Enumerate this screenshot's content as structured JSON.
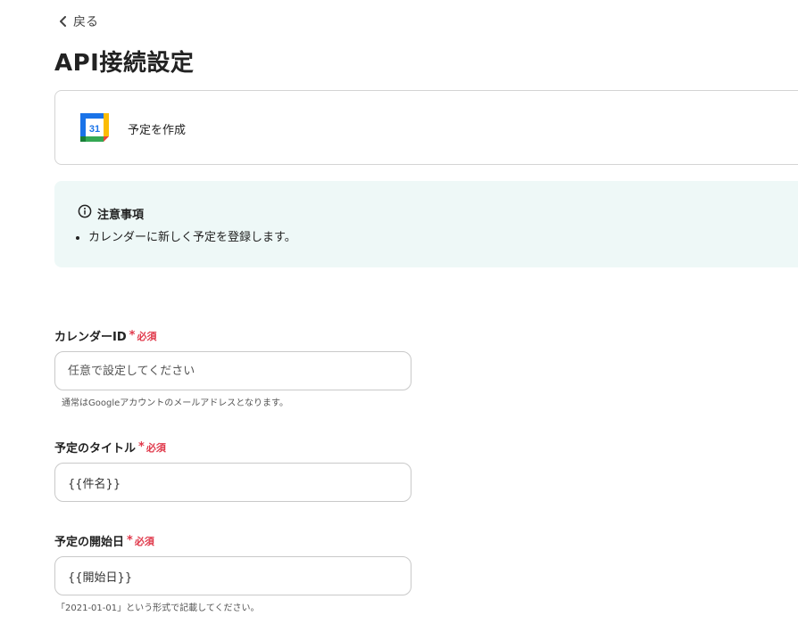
{
  "nav": {
    "back_label": "戻る"
  },
  "page": {
    "title": "API接続設定"
  },
  "action": {
    "icon": "google-calendar-icon",
    "icon_text": "31",
    "label": "予定を作成"
  },
  "notice": {
    "title": "注意事項",
    "items": [
      "カレンダーに新しく予定を登録します。"
    ]
  },
  "form": {
    "required_star": "*",
    "required_text": "必須",
    "fields": [
      {
        "label": "カレンダーID",
        "value": "",
        "placeholder": "任意で設定してください",
        "hint": "通常はGoogleアカウントのメールアドレスとなります。"
      },
      {
        "label": "予定のタイトル",
        "value": "{{件名}}",
        "placeholder": "",
        "hint": ""
      },
      {
        "label": "予定の開始日",
        "value": "{{開始日}}",
        "placeholder": "",
        "hint": "「2021-01-01」という形式で記載してください。"
      }
    ]
  },
  "colors": {
    "required": "#e0384a",
    "notice_bg": "#eef8f7",
    "border": "#c9c9c9"
  }
}
